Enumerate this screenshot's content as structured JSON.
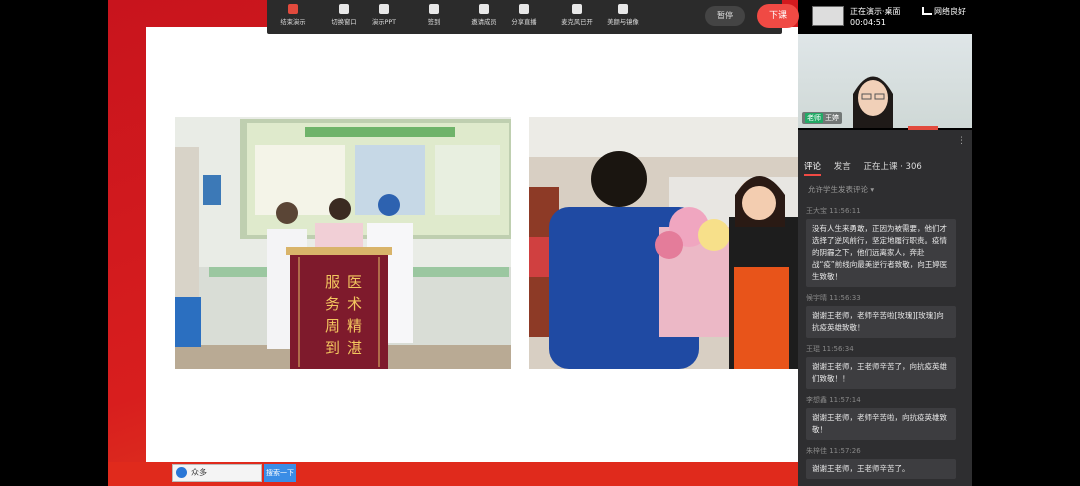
{
  "toolbar": {
    "items": [
      {
        "label": "结束演示",
        "icon": "stop-presentation-icon"
      },
      {
        "label": "切换窗口",
        "icon": "switch-window-icon"
      },
      {
        "label": "演示PPT",
        "icon": "ppt-icon"
      },
      {
        "label": "签到",
        "icon": "checkin-icon"
      },
      {
        "label": "邀请成员",
        "icon": "invite-members-icon"
      },
      {
        "label": "分享直播",
        "icon": "share-icon"
      },
      {
        "label": "麦克风已开",
        "icon": "microphone-icon"
      },
      {
        "label": "美颜与镜像",
        "icon": "beauty-icon"
      }
    ],
    "pause_label": "暂停",
    "stop_label": "下课"
  },
  "status": {
    "title": "正在演示·桌面",
    "time": "00:04:51",
    "network": "网络良好"
  },
  "video": {
    "badge": "老师",
    "name": "王婷"
  },
  "panel": {
    "tabs": [
      {
        "label": "评论",
        "active": true
      },
      {
        "label": "发言",
        "active": false
      },
      {
        "label": "正在上课 · 306",
        "active": false
      }
    ],
    "permission": "允许学生发表评论 ▾",
    "comments": [
      {
        "meta": "王大宝  11:56:11",
        "text": "没有人生来勇敢，正因为被需要，他们才选择了逆风前行，坚定地履行职责。疫情的阴霾之下，他们远离家人，奔赴战“疫”前线向最美逆行者致敬，向王婷医生致敬！"
      },
      {
        "meta": "候宇晴  11:56:33",
        "text": "谢谢王老师，老师辛苦啦[玫瑰][玫瑰]向抗疫英雄致敬！"
      },
      {
        "meta": "王琨  11:56:34",
        "text": "谢谢王老师，王老师辛苦了，向抗疫英雄们致敬！！"
      },
      {
        "meta": "李想鑫  11:57:14",
        "text": "谢谢王老师，老师辛苦啦，向抗疫英雄致敬！"
      },
      {
        "meta": "朱梓佳  11:57:26",
        "text": "谢谢王老师，王老师辛苦了。"
      }
    ]
  },
  "slide": {
    "banner_chars": [
      "服",
      "医",
      "务",
      "术",
      "周",
      "精",
      "到",
      "湛"
    ]
  },
  "taskbar": {
    "search_text": "众多",
    "button_label": "搜索一下"
  }
}
